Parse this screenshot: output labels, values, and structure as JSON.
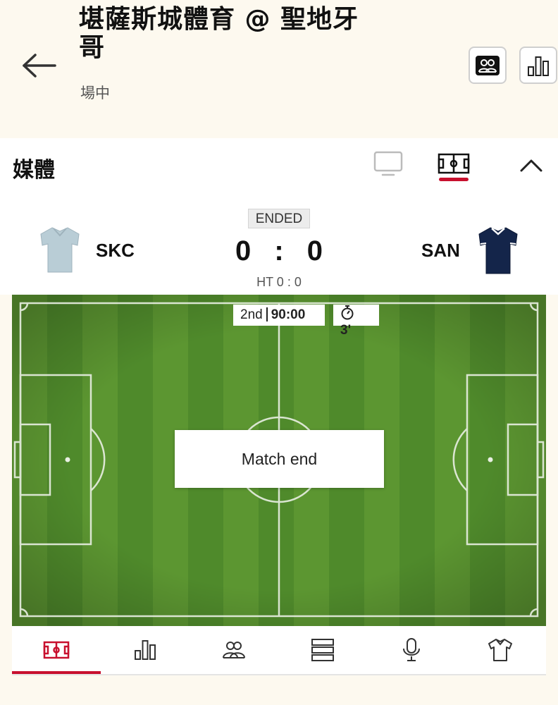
{
  "header": {
    "title": "堪薩斯城體育 @ 聖地牙哥",
    "subtitle": "場中"
  },
  "media": {
    "title": "媒體"
  },
  "match": {
    "status": "ENDED",
    "home_team": "SKC",
    "away_team": "SAN",
    "home_score": "0",
    "score_separator": ":",
    "away_score": "0",
    "halftime": "HT 0 : 0",
    "period": "2nd",
    "time": "90:00",
    "added_time": "3'",
    "overlay_text": "Match end"
  },
  "colors": {
    "accent": "#c8102e",
    "home_shirt": "#b9cdd6",
    "away_shirt": "#14254a",
    "pitch_dark": "#4f8a2b",
    "pitch_light": "#5c9631"
  },
  "icons": {
    "back": "arrow-left-icon",
    "lineups": "lineups-icon",
    "stats": "stats-icon",
    "tv": "tv-icon",
    "pitch": "pitch-icon",
    "collapse": "chevron-up-icon",
    "tabs": [
      "pitch-icon",
      "stats-icon",
      "lineups-icon",
      "timeline-icon",
      "commentary-microphone-icon",
      "shirt-icon"
    ]
  },
  "tabs": {
    "selected_index": 0
  }
}
